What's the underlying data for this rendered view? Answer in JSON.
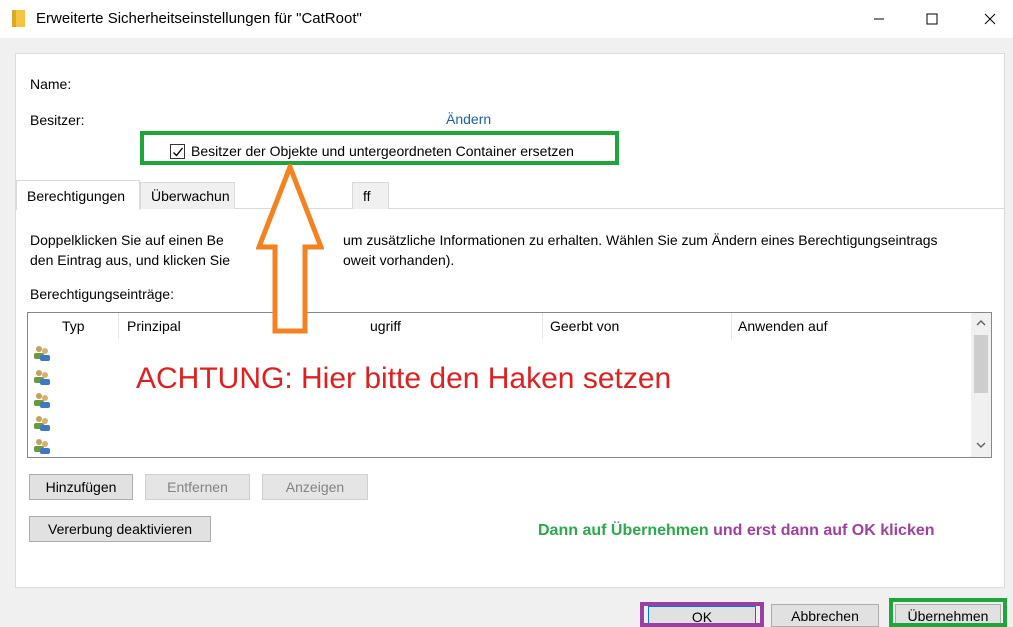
{
  "window": {
    "title": "Erweiterte Sicherheitseinstellungen für \"CatRoot\""
  },
  "fields": {
    "name_label": "Name:",
    "owner_label": "Besitzer:",
    "change_link": "Ändern",
    "replace_owner_label": "Besitzer der Objekte und untergeordneten Container ersetzen",
    "replace_owner_checked": true
  },
  "tabs": [
    {
      "label": "Berechtigungen"
    },
    {
      "label": "Überwachun"
    },
    {
      "label": "ff"
    }
  ],
  "info": {
    "line1_left": "Doppelklicken Sie auf einen Be",
    "line1_right": "um zusätzliche Informationen zu erhalten. Wählen Sie zum Ändern eines Berechtigungseintrags",
    "line2_left": "den Eintrag aus, und klicken Sie",
    "line2_right": "oweit vorhanden)."
  },
  "entries_label": "Berechtigungseinträge:",
  "table": {
    "columns": [
      "Typ",
      "Prinzipal",
      "ugriff",
      "Geerbt von",
      "Anwenden auf"
    ],
    "row_count": 5
  },
  "buttons": {
    "add": "Hinzufügen",
    "remove": "Entfernen",
    "view": "Anzeigen",
    "disable_inheritance": "Vererbung deaktivieren",
    "ok": "OK",
    "cancel": "Abbrechen",
    "apply": "Übernehmen"
  },
  "annotations": {
    "warning": "ACHTUNG: Hier bitte den Haken setzen",
    "hint_green": "Dann auf Übernehmen",
    "hint_purple": " und erst dann auf OK klicken"
  },
  "colors": {
    "annotation_green": "#1fa63a",
    "annotation_orange": "#f58220",
    "annotation_red": "#e02020",
    "annotation_purple": "#9b3fa6",
    "link_blue": "#1a5fb4"
  }
}
